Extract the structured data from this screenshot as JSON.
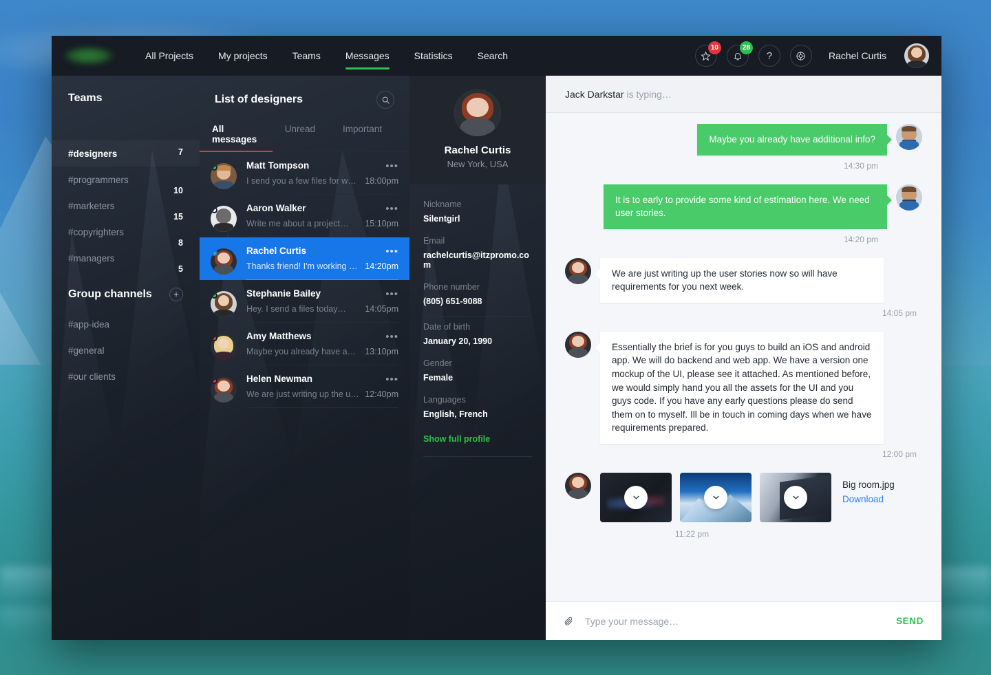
{
  "topnav": {
    "logo_name": "app-logo",
    "items": [
      {
        "label": "All Projects",
        "active": false
      },
      {
        "label": "My projects",
        "active": false
      },
      {
        "label": "Teams",
        "active": false
      },
      {
        "label": "Messages",
        "active": true
      },
      {
        "label": "Statistics",
        "active": false
      },
      {
        "label": "Search",
        "active": false
      }
    ],
    "star_badge": "10",
    "bell_badge": "28",
    "help_icon": "question-mark-icon",
    "settings_icon": "lifebuoy-icon",
    "user_name": "Rachel Curtis"
  },
  "sidebar": {
    "title": "Teams",
    "teams": [
      {
        "label": "#designers",
        "count": "7",
        "active": true
      },
      {
        "label": "#programmers",
        "count": "10",
        "active": false
      },
      {
        "label": "#marketers",
        "count": "15",
        "active": false
      },
      {
        "label": "#copyrighters",
        "count": "8",
        "active": false
      },
      {
        "label": "#managers",
        "count": "5",
        "active": false
      }
    ],
    "group_title": "Group channels",
    "add_label": "+",
    "channels": [
      {
        "label": "#app-idea"
      },
      {
        "label": "#general"
      },
      {
        "label": "#our clients"
      }
    ]
  },
  "msglist": {
    "title": "List of designers",
    "search_icon": "search-icon",
    "tabs": [
      {
        "label": "All messages",
        "active": true
      },
      {
        "label": "Unread",
        "active": false
      },
      {
        "label": "Important",
        "active": false
      }
    ],
    "conversations": [
      {
        "name": "Matt Tompson",
        "preview": "I send you a few files for works…",
        "time": "18:00pm",
        "status": "green",
        "avatar": "guy",
        "selected": false
      },
      {
        "name": "Aaron Walker",
        "preview": "Write me about a project…",
        "time": "15:10pm",
        "status": "white",
        "avatar": "bw",
        "selected": false
      },
      {
        "name": "Rachel Curtis",
        "preview": "Thanks friend! I'm working now…",
        "time": "14:20pm",
        "status": "green",
        "avatar": "red",
        "selected": true
      },
      {
        "name": "Stephanie Bailey",
        "preview": "Hey. I send a files today…",
        "time": "14:05pm",
        "status": "green",
        "avatar": "brun",
        "selected": false
      },
      {
        "name": "Amy Matthews",
        "preview": "Maybe you already have add…",
        "time": "13:10pm",
        "status": "red",
        "avatar": "blond",
        "selected": false
      },
      {
        "name": "Helen Newman",
        "preview": "We are just writing up the user…",
        "time": "12:40pm",
        "status": "red",
        "avatar": "red",
        "selected": false
      }
    ],
    "more_dots": "•••"
  },
  "profile": {
    "name": "Rachel Curtis",
    "location": "New York, USA",
    "fields": [
      {
        "label": "Nickname",
        "value": "Silentgirl"
      },
      {
        "label": "Email",
        "value": "rachelcurtis@itzpromo.com"
      },
      {
        "label": "Phone number",
        "value": "(805) 651-9088"
      },
      {
        "label": "Date of birth",
        "value": "January 20, 1990"
      },
      {
        "label": "Gender",
        "value": "Female"
      },
      {
        "label": "Languages",
        "value": "English, French"
      }
    ],
    "show_full_profile": "Show full profile"
  },
  "chat": {
    "typing_name": "Jack Darkstar",
    "typing_suffix": " is typing…",
    "messages": [
      {
        "dir": "out",
        "text": "Maybe you already have additional info?",
        "time": "14:30 pm",
        "avatar": "bearded"
      },
      {
        "dir": "out",
        "text": "It is to early to provide some kind of estimation here. We need user stories.",
        "time": "14:20 pm",
        "avatar": "bearded"
      },
      {
        "dir": "in",
        "text": "We are just writing up the user stories now so will have requirements for you next week.",
        "time": "14:05 pm",
        "avatar": "red"
      },
      {
        "dir": "in",
        "text": "Essentially the brief is for you guys to build an iOS and android app. We will do backend and web app. We have a version one mockup of the UI, please see it attached. As mentioned before, we would simply hand you all the assets for the UI and you guys code. If you have any early questions please do send them on to myself. Ill be in touch in coming days when we have requirements prepared.",
        "time": "12:00 pm",
        "avatar": "red"
      }
    ],
    "attachment": {
      "avatar": "red",
      "thumbs": [
        "dashboard-thumbnail",
        "mountain-thumbnail",
        "laptop-thumbnail"
      ],
      "file_name": "Big room.jpg",
      "download_label": "Download",
      "time": "11:22 pm",
      "expand_icon": "chevron-down-icon"
    },
    "composer": {
      "clip_icon": "paperclip-icon",
      "placeholder": "Type your message…",
      "value": "",
      "send_label": "SEND"
    }
  },
  "colors": {
    "accent_green": "#2fbf4e",
    "bubble_green": "#49cb6a",
    "selected_blue": "#1877e8",
    "tab_red": "#e8343c",
    "link_blue": "#2f80ed"
  }
}
